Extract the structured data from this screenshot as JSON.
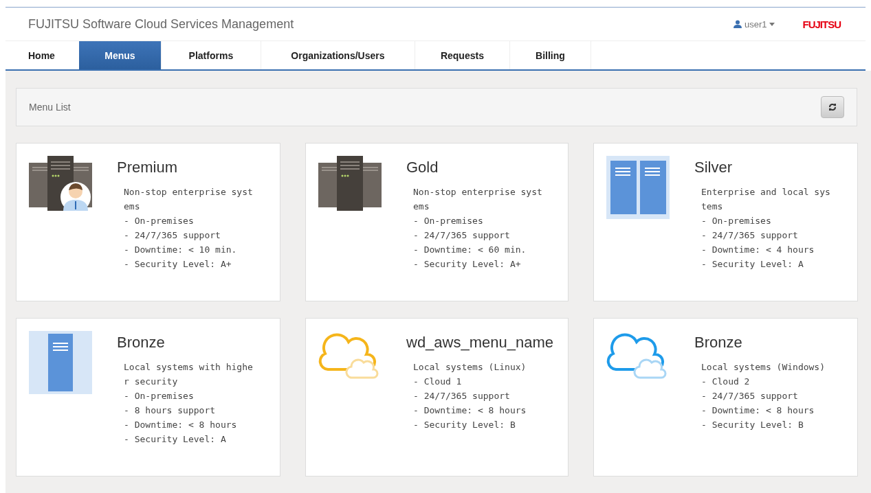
{
  "header": {
    "title": "FUJITSU Software Cloud Services Management",
    "user": "user1",
    "logo": "FUJITSU"
  },
  "tabs": [
    {
      "label": "Home",
      "selected": false
    },
    {
      "label": "Menus",
      "selected": true
    },
    {
      "label": "Platforms",
      "selected": false
    },
    {
      "label": "Organizations/Users",
      "selected": false
    },
    {
      "label": "Requests",
      "selected": false
    },
    {
      "label": "Billing",
      "selected": false
    }
  ],
  "panel": {
    "title": "Menu List"
  },
  "cards": [
    {
      "name": "Premium",
      "kind": "server-person",
      "lines": [
        "Non-stop enterprise systems",
        "- On-premises",
        "- 24/7/365 support",
        "- Downtime: < 10 min.",
        "- Security Level: A+"
      ]
    },
    {
      "name": "Gold",
      "kind": "server",
      "lines": [
        "Non-stop enterprise systems",
        "- On-premises",
        "- 24/7/365 support",
        "- Downtime: < 60 min.",
        "- Security Level: A+"
      ]
    },
    {
      "name": "Silver",
      "kind": "blue-double",
      "lines": [
        "Enterprise and local systems",
        "- On-premises",
        "- 24/7/365 support",
        "- Downtime: < 4 hours",
        "- Security Level: A"
      ]
    },
    {
      "name": "Bronze",
      "kind": "blue-single",
      "lines": [
        "Local systems with higher security",
        "- On-premises",
        "- 8 hours support",
        "- Downtime: < 8 hours",
        "- Security Level: A"
      ]
    },
    {
      "name": "wd_aws_menu_name",
      "kind": "cloud-orange",
      "lines": [
        "Local systems (Linux)",
        "- Cloud 1",
        "- 24/7/365 support",
        "- Downtime: < 8 hours",
        "- Security Level: B"
      ]
    },
    {
      "name": "Bronze",
      "kind": "cloud-blue",
      "lines": [
        "Local systems (Windows)",
        "- Cloud 2",
        "- 24/7/365 support",
        "- Downtime: < 8 hours",
        "- Security Level: B"
      ]
    }
  ]
}
